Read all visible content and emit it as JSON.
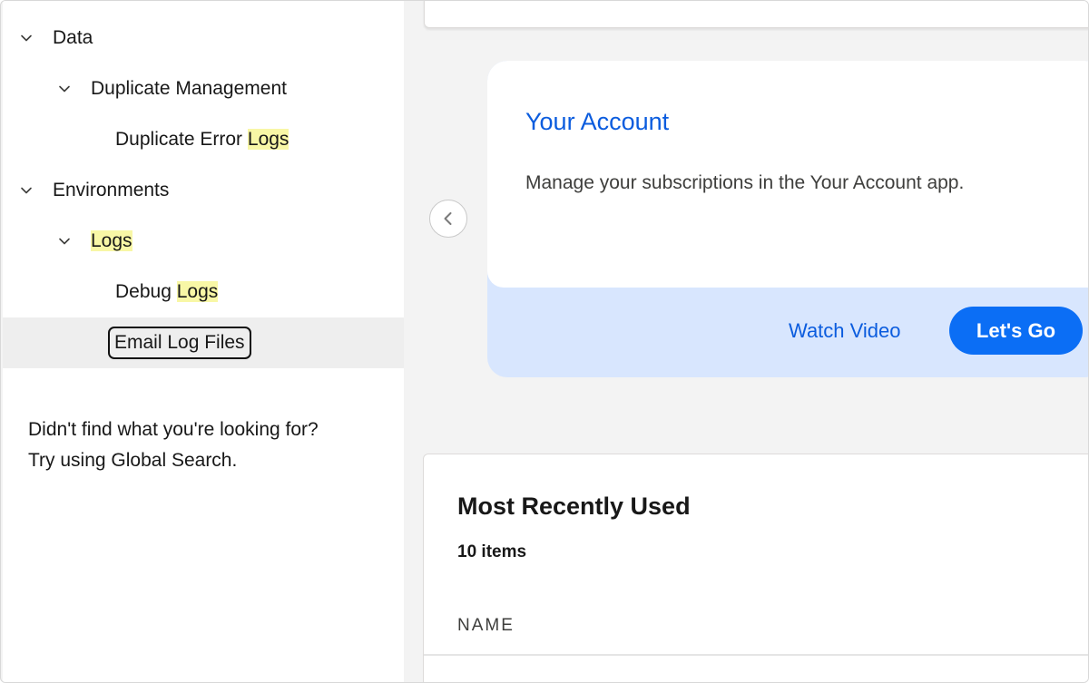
{
  "tree": {
    "items": [
      {
        "level": 0,
        "expanded": true,
        "parts": [
          {
            "text": "Data",
            "hl": false
          }
        ]
      },
      {
        "level": 1,
        "expanded": true,
        "parts": [
          {
            "text": "Duplicate Management",
            "hl": false
          }
        ]
      },
      {
        "level": 2,
        "expanded": false,
        "parts": [
          {
            "text": "Duplicate Error ",
            "hl": false
          },
          {
            "text": "Logs",
            "hl": true
          }
        ]
      },
      {
        "level": 0,
        "expanded": true,
        "parts": [
          {
            "text": "Environments",
            "hl": false
          }
        ]
      },
      {
        "level": 1,
        "expanded": true,
        "parts": [
          {
            "text": "Logs",
            "hl": true
          }
        ]
      },
      {
        "level": 2,
        "expanded": false,
        "parts": [
          {
            "text": "Debug ",
            "hl": false
          },
          {
            "text": "Logs",
            "hl": true
          }
        ]
      },
      {
        "level": 2,
        "expanded": false,
        "selected": true,
        "parts": [
          {
            "text": "Email Log Files",
            "hl": false
          }
        ]
      }
    ],
    "not_found_line1": "Didn't find what you're looking for?",
    "not_found_line2": "Try using Global Search."
  },
  "promo": {
    "title": "Your Account",
    "description": "Manage your subscriptions in the Your Account app.",
    "watch_label": "Watch Video",
    "go_label": "Let's Go"
  },
  "mru": {
    "title": "Most Recently Used",
    "count": "10 items",
    "column_name": "NAME"
  },
  "colors": {
    "accent": "#0b5cde",
    "button": "#0b6ef5",
    "highlight": "#f8f7a6",
    "promo_footer": "#d8e6fe"
  },
  "icons": {
    "tree_toggle": "chevron-down-icon",
    "carousel_prev": "chevron-left-icon"
  }
}
